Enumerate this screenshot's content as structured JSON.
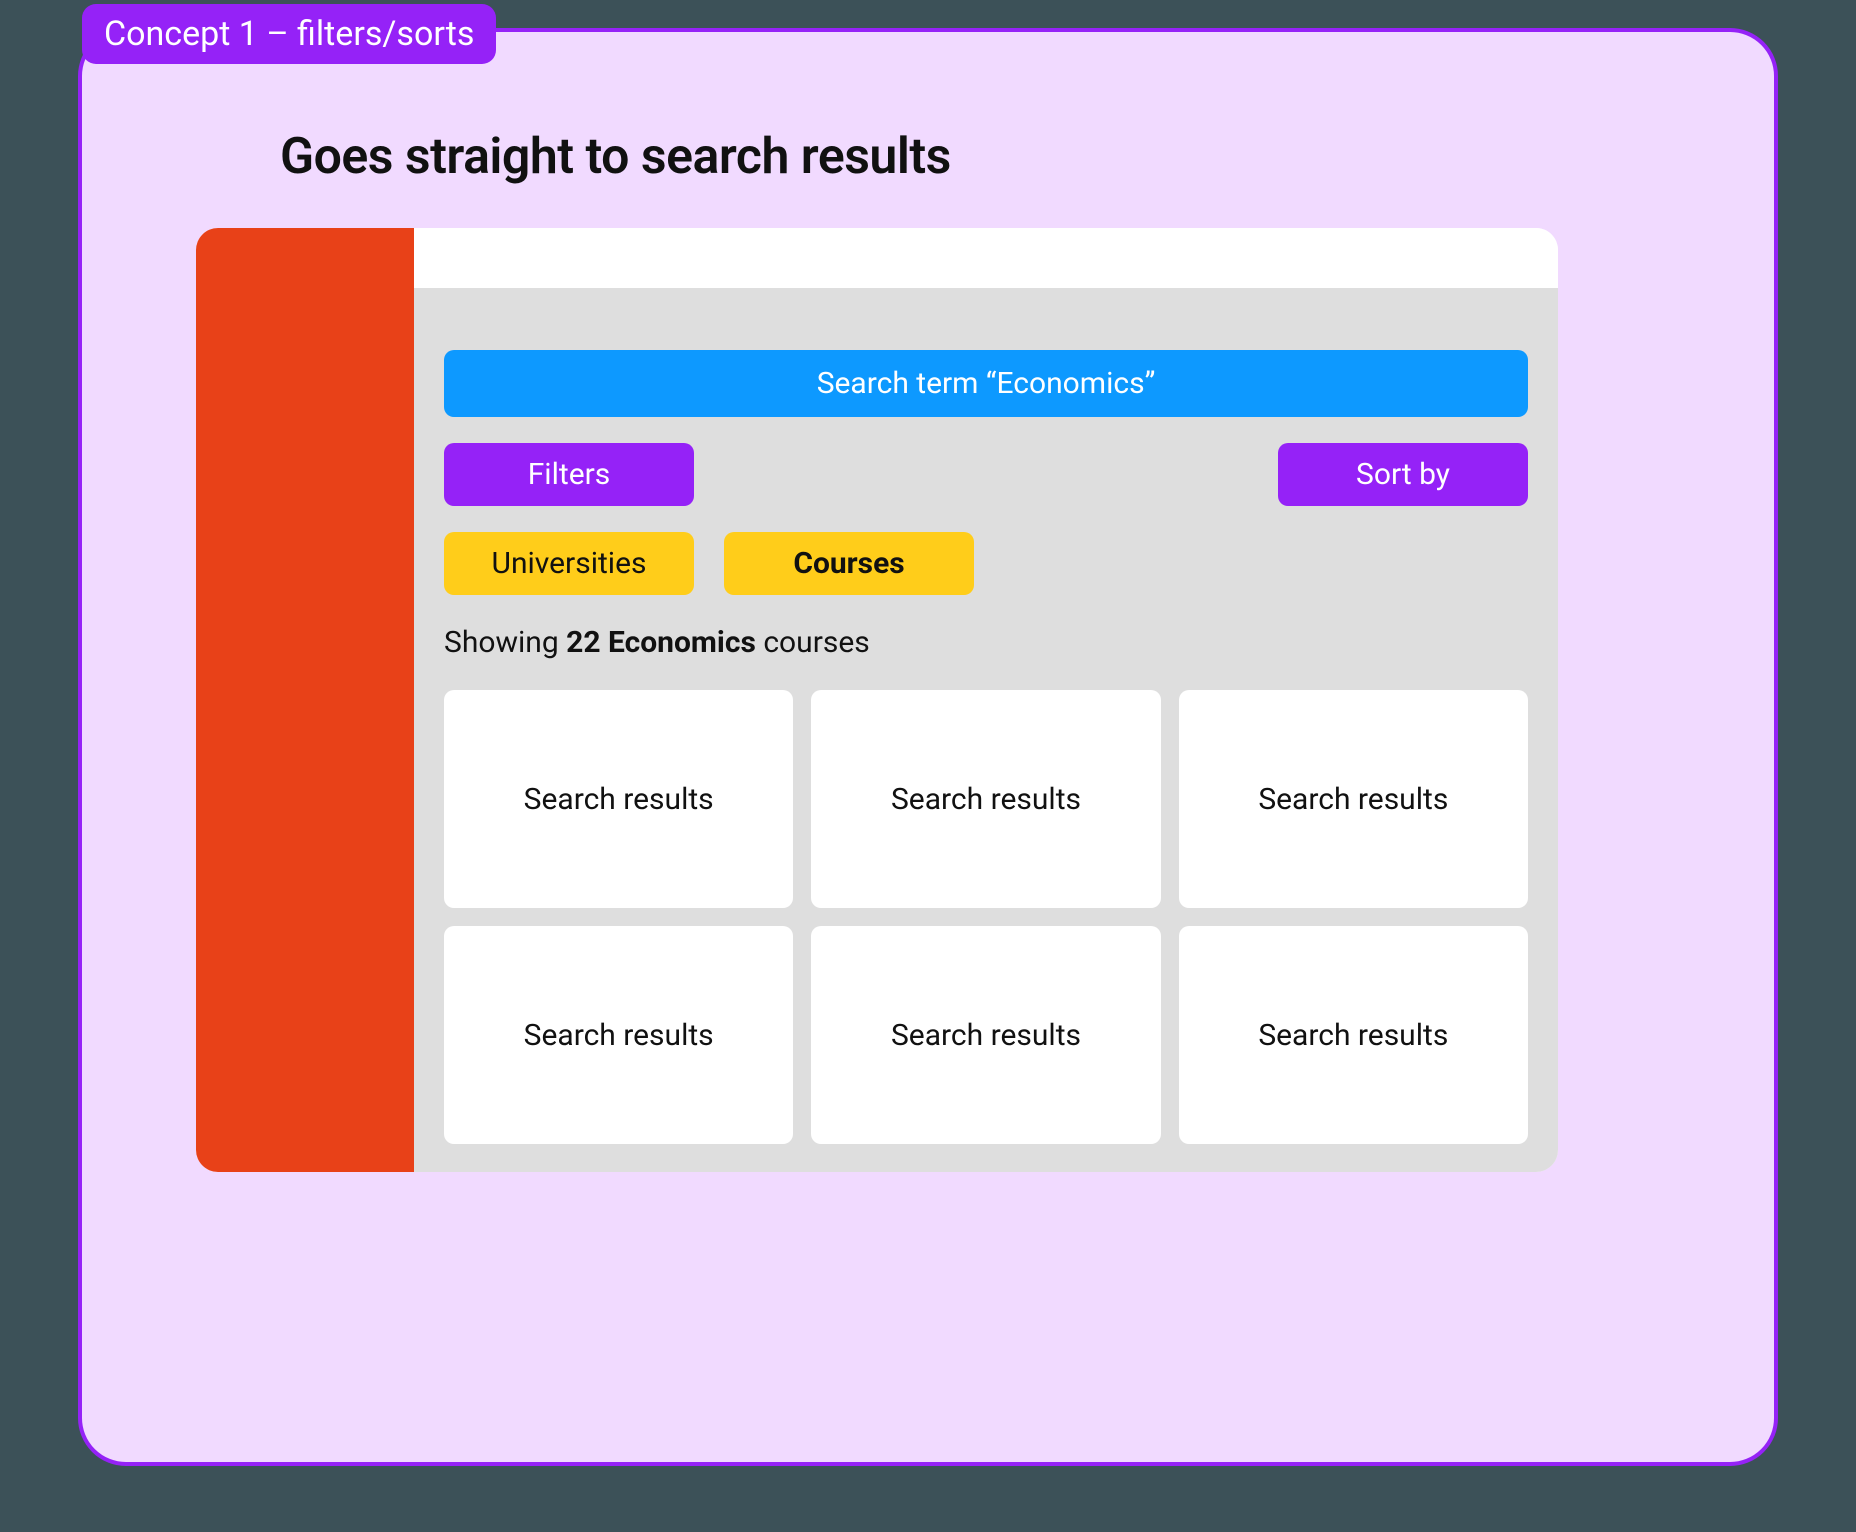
{
  "badge": "Concept 1 – filters/sorts",
  "heading": "Goes straight to search results",
  "search_bar": "Search term “Economics”",
  "filters_button": "Filters",
  "sort_button": "Sort by",
  "tabs": {
    "universities": "Universities",
    "courses": "Courses"
  },
  "showing": {
    "prefix": "Showing ",
    "bold": "22 Economics",
    "suffix": " courses"
  },
  "result_card_label": "Search results",
  "colors": {
    "badge_bg": "#9522f7",
    "panel_bg": "#f1daff",
    "sidebar_bg": "#e84118",
    "search_bg": "#0d99ff",
    "button_purple": "#9522f7",
    "button_yellow": "#ffcd1a",
    "content_bg": "#dedede"
  }
}
